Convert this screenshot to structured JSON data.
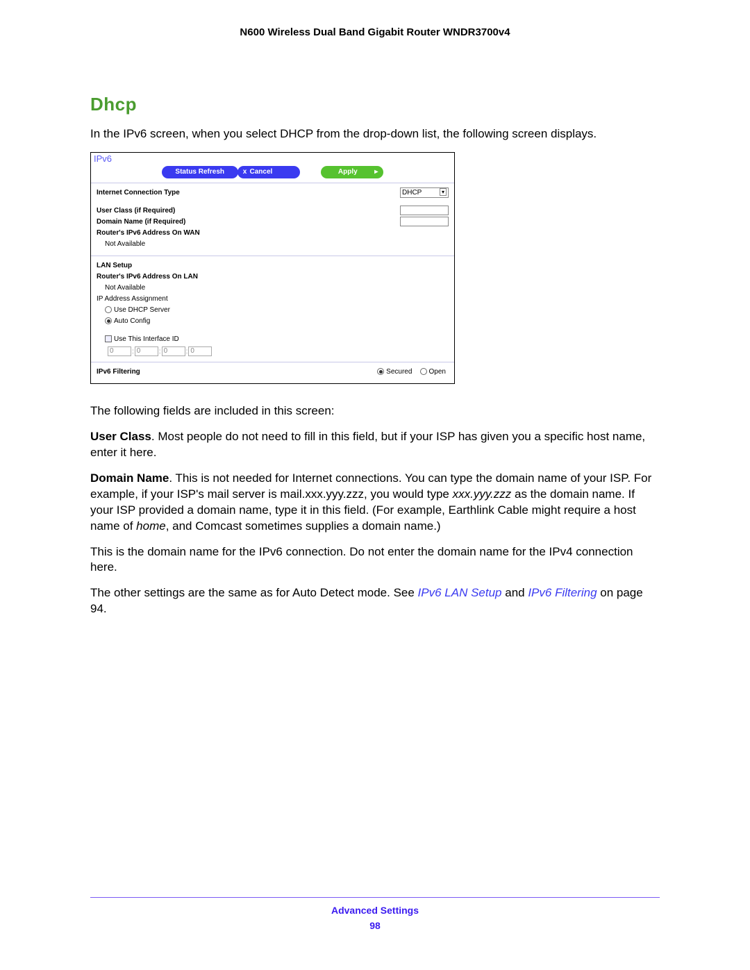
{
  "header": {
    "product_title": "N600 Wireless Dual Band Gigabit Router WNDR3700v4"
  },
  "section": {
    "title": "Dhcp",
    "intro": "In the IPv6 screen, when you select DHCP from the drop-down list, the following screen displays."
  },
  "screenshot": {
    "panel_title": "IPv6",
    "buttons": {
      "refresh": "Status Refresh",
      "cancel_x": "x",
      "cancel": "Cancel",
      "apply": "Apply",
      "apply_arrow": "▸"
    },
    "connection_section": {
      "connection_type_label": "Internet Connection Type",
      "connection_type_value": "DHCP",
      "user_class_label": "User Class (if Required)",
      "domain_name_label": "Domain Name  (if Required)",
      "wan_addr_label": "Router's IPv6 Address On WAN",
      "wan_addr_value": "Not Available"
    },
    "lan_section": {
      "title": "LAN Setup",
      "lan_addr_label": "Router's IPv6 Address On LAN",
      "lan_addr_value": "Not Available",
      "ip_assign_label": "IP Address Assignment",
      "opt_dhcp": "Use DHCP Server",
      "opt_auto": "Auto Config",
      "use_interface_id": "Use This Interface ID",
      "ifid_values": [
        "0",
        "0",
        "0",
        "0"
      ]
    },
    "filtering_section": {
      "label": "IPv6 Filtering",
      "opt_secured": "Secured",
      "opt_open": "Open"
    }
  },
  "body": {
    "fields_intro": "The following fields are included in this screen:",
    "user_class_bold": "User Class",
    "user_class_text": ". Most people do not need to fill in this field, but if your ISP has given you a specific host name, enter it here.",
    "domain_name_bold": "Domain Name",
    "domain_name_text_1": ". This is not needed for Internet connections. You can type the domain name of your ISP. For example, if your ISP's mail server is mail.xxx.yyy.zzz, you would type ",
    "domain_name_italic_1": "xxx.yyy.zzz",
    "domain_name_text_2": " as the domain name. If your ISP provided a domain name, type it in this field. (For example, Earthlink Cable might require a host name of ",
    "domain_name_italic_2": "home",
    "domain_name_text_3": ", and Comcast sometimes supplies a domain name.)",
    "ipv4_note": "This is the domain name for the IPv6 connection. Do not enter the domain name for the IPv4 connection here.",
    "other_1": "The other settings are the same as for Auto Detect mode. See ",
    "link_1": "IPv6 LAN Setup ",
    "other_2": " and ",
    "link_2": "IPv6 Filtering",
    "other_3": " on page 94."
  },
  "footer": {
    "section": "Advanced Settings",
    "page": "98"
  }
}
